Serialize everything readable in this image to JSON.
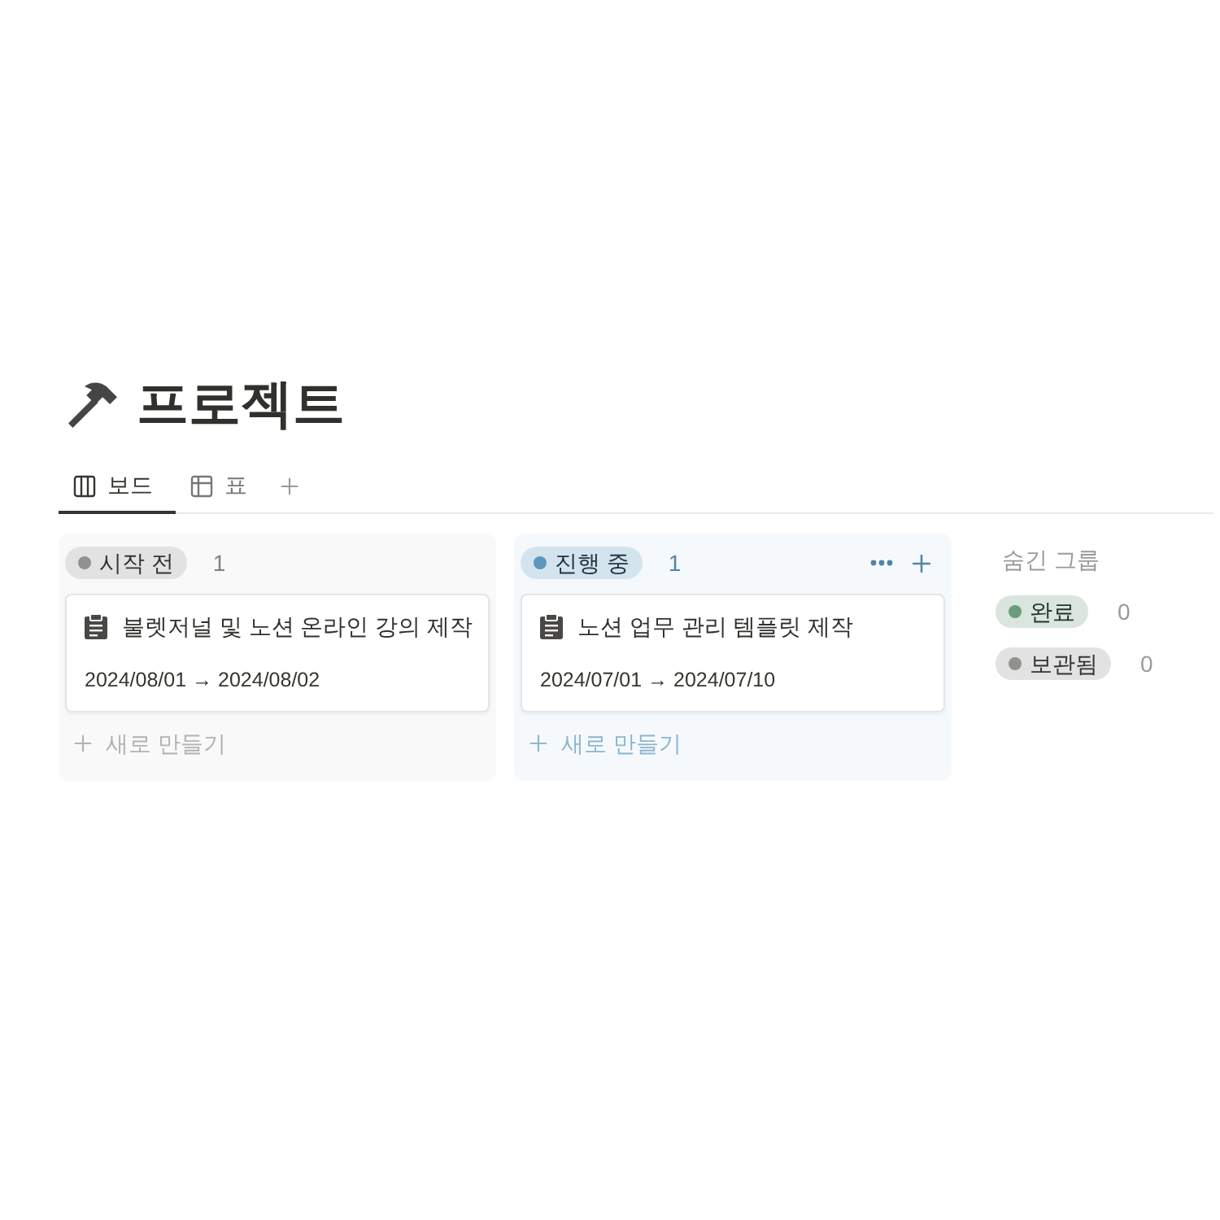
{
  "page": {
    "title": "프로젝트"
  },
  "views": [
    {
      "label": "보드",
      "kind": "board",
      "selected": true
    },
    {
      "label": "표",
      "kind": "table",
      "selected": false
    }
  ],
  "columns": [
    {
      "status": "시작 전",
      "color": "#91918e",
      "count": "1",
      "actions_visible": false,
      "cards": [
        {
          "title": "불렛저널 및 노션 온라인 강의 제작",
          "dates": "2024/08/01 → 2024/08/02"
        }
      ],
      "new_label": "새로 만들기"
    },
    {
      "status": "진행 중",
      "color": "#5b97bd",
      "count": "1",
      "actions_visible": true,
      "cards": [
        {
          "title": "노션 업무 관리 템플릿 제작",
          "dates": "2024/07/01 → 2024/07/10"
        }
      ],
      "new_label": "새로 만들기"
    }
  ],
  "hidden_groups": {
    "heading": "숨긴 그룹",
    "groups": [
      {
        "status": "완료",
        "color": "#6c9b7d",
        "count": "0"
      },
      {
        "status": "보관됨",
        "color": "#91918e",
        "count": "0"
      }
    ]
  }
}
